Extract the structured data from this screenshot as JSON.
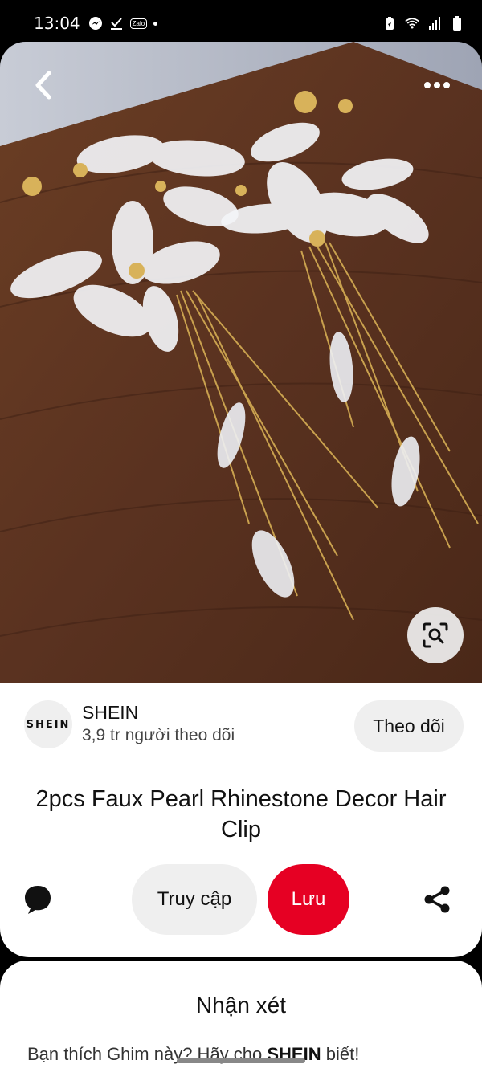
{
  "status_bar": {
    "time": "13:04",
    "left_icons": [
      "messenger-icon",
      "download-check-icon",
      "zalo-icon",
      "notification-dot"
    ],
    "zalo_label": "Zalo",
    "right_icons": [
      "battery-saver-icon",
      "wifi-icon",
      "signal-icon",
      "battery-icon"
    ]
  },
  "pin": {
    "image_alt_icons": [
      "back-icon",
      "more-icon",
      "visual-search-icon"
    ]
  },
  "profile": {
    "avatar_text": "SHEIN",
    "name": "SHEIN",
    "followers": "3,9 tr người theo dõi",
    "follow_label": "Theo dõi"
  },
  "title": "2pcs Faux Pearl Rhinestone Decor Hair Clip",
  "actions": {
    "visit_label": "Truy cập",
    "save_label": "Lưu",
    "save_color": "#e60023"
  },
  "comments": {
    "title": "Nhận xét",
    "prompt_prefix": "Bạn thích Ghim này? Hãy cho ",
    "prompt_brand": "SHEIN",
    "prompt_suffix": " biết!"
  }
}
